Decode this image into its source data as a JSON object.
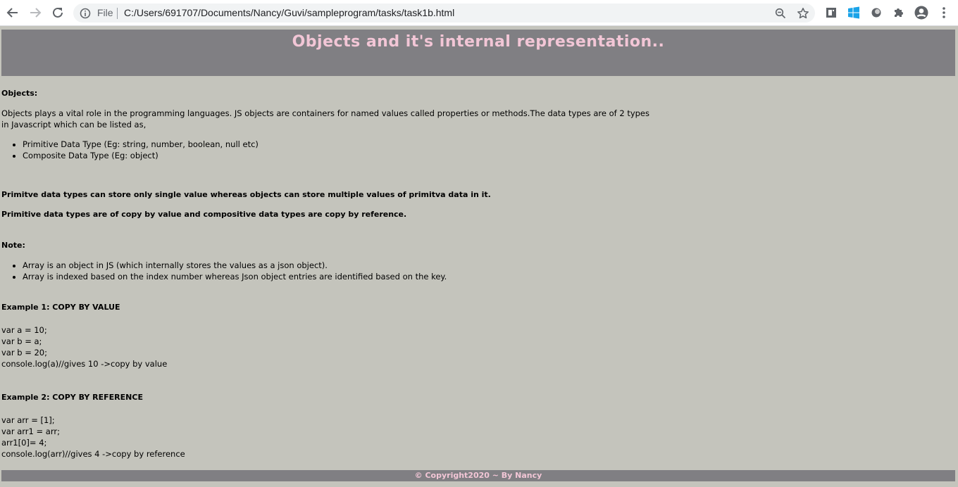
{
  "browser": {
    "file_label": "File",
    "url": "C:/Users/691707/Documents/Nancy/Guvi/sampleprogram/tasks/task1b.html"
  },
  "page": {
    "title": "Objects and it's internal representation..",
    "objects_heading": "Objects:",
    "intro_line1": "Objects plays a vital role in the programming languages. JS objects are containers for named values called properties or methods.The data types are of 2 types",
    "intro_line2": "in Javascript which can be listed as,",
    "types": [
      "Primitive Data Type (Eg: string, number, boolean, null etc)",
      "Composite Data Type (Eg: object)"
    ],
    "primitive_statement": "Primitve data types can store only single value whereas objects can store multiple values of primitva data in it.",
    "copy_statement": "Primitive data types are of copy by value and compositive data types are copy by reference.",
    "note_heading": "Note:",
    "notes": [
      "Array is an object in JS (which internally stores the values as a json object).",
      "Array is indexed based on the index number whereas Json object entries are identified based on the key."
    ],
    "example1_heading": "Example 1: COPY BY VALUE",
    "example1_code": [
      "var a = 10;",
      "var b = a;",
      "var b = 20;",
      "console.log(a)//gives 10 ->copy by value"
    ],
    "example2_heading": "Example 2: COPY BY REFERENCE",
    "example2_code": [
      "var arr = [1];",
      "var arr1 = arr;",
      "arr1[0]= 4;",
      "console.log(arr)//gives 4 ->copy by reference"
    ],
    "footer": "© Copyright2020 ~ By Nancy"
  },
  "colors": {
    "page_background": "#c4c4bc",
    "header_background": "#807f83",
    "title_color": "#f2c6d6"
  },
  "icons": {
    "back": "arrow-left-icon",
    "forward": "arrow-right-icon",
    "reload": "reload-icon",
    "info": "info-icon",
    "zoom": "zoom-icon",
    "bookmark": "star-icon",
    "extensions": [
      "reader-icon",
      "windows-icon",
      "circle-extension-icon",
      "puzzle-icon",
      "profile-icon",
      "kebab-menu-icon"
    ]
  }
}
